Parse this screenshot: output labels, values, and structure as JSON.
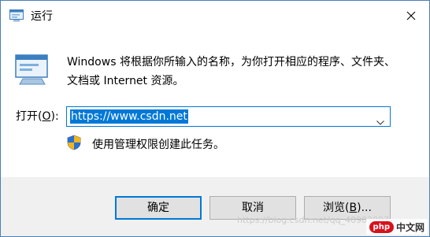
{
  "window": {
    "title": "运行",
    "close_icon": "close-icon",
    "border_color": "#4a7fb0"
  },
  "content": {
    "app_icon": "run-app-icon",
    "description": "Windows 将根据你所输入的名称，为你打开相应的程序、文件夹、文档或 Internet 资源。",
    "open_label_prefix": "打开(",
    "open_label_key": "O",
    "open_label_suffix": "):",
    "input_value": "https://www.csdn.net",
    "dropdown_icon": "chevron-down-icon",
    "admin_icon": "uac-shield-icon",
    "admin_note": "使用管理权限创建此任务。",
    "accent_color": "#0078d7"
  },
  "buttons": {
    "ok": "确定",
    "cancel": "取消",
    "browse_prefix": "浏览(",
    "browse_key": "B",
    "browse_suffix": ")..."
  },
  "watermark": {
    "url": "https://blog.csdn.net/qq_40902097",
    "badge": "php",
    "site": "中文网"
  }
}
